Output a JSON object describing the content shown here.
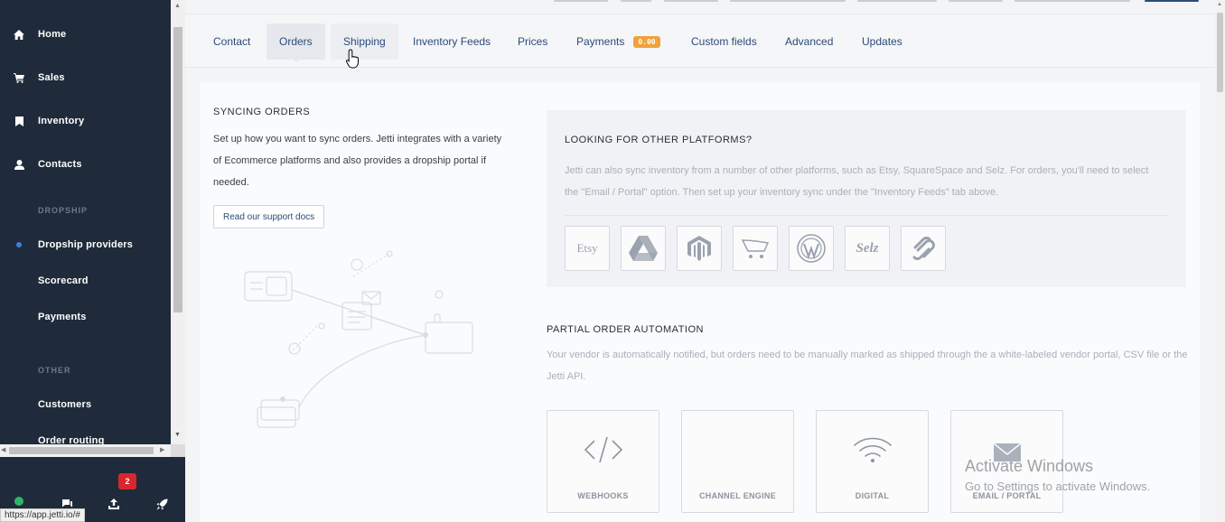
{
  "sidebar": {
    "items": [
      {
        "label": "Home",
        "icon": "home-icon"
      },
      {
        "label": "Sales",
        "icon": "cart-icon"
      },
      {
        "label": "Inventory",
        "icon": "bookmark-icon"
      },
      {
        "label": "Contacts",
        "icon": "user-icon"
      }
    ],
    "section_dropship": "DROPSHIP",
    "dropship_items": [
      {
        "label": "Dropship providers"
      },
      {
        "label": "Scorecard"
      },
      {
        "label": "Payments"
      }
    ],
    "section_other": "OTHER",
    "other_items": [
      {
        "label": "Customers"
      },
      {
        "label": "Order routing"
      }
    ],
    "bottom": {
      "notification_count": "2",
      "icons": [
        "status-online-icon",
        "chat-icon",
        "upload-icon",
        "rocket-icon"
      ]
    }
  },
  "status_url": "https://app.jetti.io/#",
  "tabs": [
    {
      "label": "Contact"
    },
    {
      "label": "Orders"
    },
    {
      "label": "Shipping"
    },
    {
      "label": "Inventory Feeds"
    },
    {
      "label": "Prices"
    },
    {
      "label": "Payments",
      "badge": "0.00"
    },
    {
      "label": "Custom fields"
    },
    {
      "label": "Advanced"
    },
    {
      "label": "Updates"
    }
  ],
  "syncing": {
    "title": "SYNCING ORDERS",
    "description": "Set up how you want to sync orders. Jetti integrates with a variety of Ecommerce platforms and also provides a dropship portal if needed.",
    "docs_button": "Read our support docs"
  },
  "other_platforms": {
    "title": "LOOKING FOR OTHER PLATFORMS?",
    "description": "Jetti can also sync inventory from a number of other platforms, such as Etsy, SquareSpace and Selz. For orders, you'll need to select the \"Email / Portal\" option. Then set up your inventory sync under the \"Inventory Feeds\" tab above.",
    "platforms": [
      {
        "name": "etsy-logo",
        "text": "Etsy"
      },
      {
        "name": "google-drive-logo"
      },
      {
        "name": "magento-logo"
      },
      {
        "name": "opencart-logo"
      },
      {
        "name": "wordpress-logo"
      },
      {
        "name": "selz-logo",
        "text": "Selz"
      },
      {
        "name": "squarespace-logo"
      }
    ]
  },
  "partial": {
    "title": "PARTIAL ORDER AUTOMATION",
    "description": "Your vendor is automatically notified, but orders need to be manually marked as shipped through the a white-labeled vendor portal, CSV file or the Jetti API.",
    "cards": [
      {
        "label": "WEBHOOKS",
        "icon": "code-icon"
      },
      {
        "label": "CHANNEL ENGINE",
        "icon": ""
      },
      {
        "label": "DIGITAL",
        "icon": "wifi-icon"
      },
      {
        "label": "EMAIL / PORTAL",
        "icon": "envelope-icon"
      }
    ]
  },
  "watermark": {
    "line1": "Activate Windows",
    "line2": "Go to Settings to activate Windows."
  },
  "colors": {
    "sidebar_bg": "#1f2b3a",
    "tab_text": "#2b4a78",
    "badge_orange": "#f0a23b",
    "notification_red": "#d8262d",
    "status_green": "#2fb56a"
  }
}
